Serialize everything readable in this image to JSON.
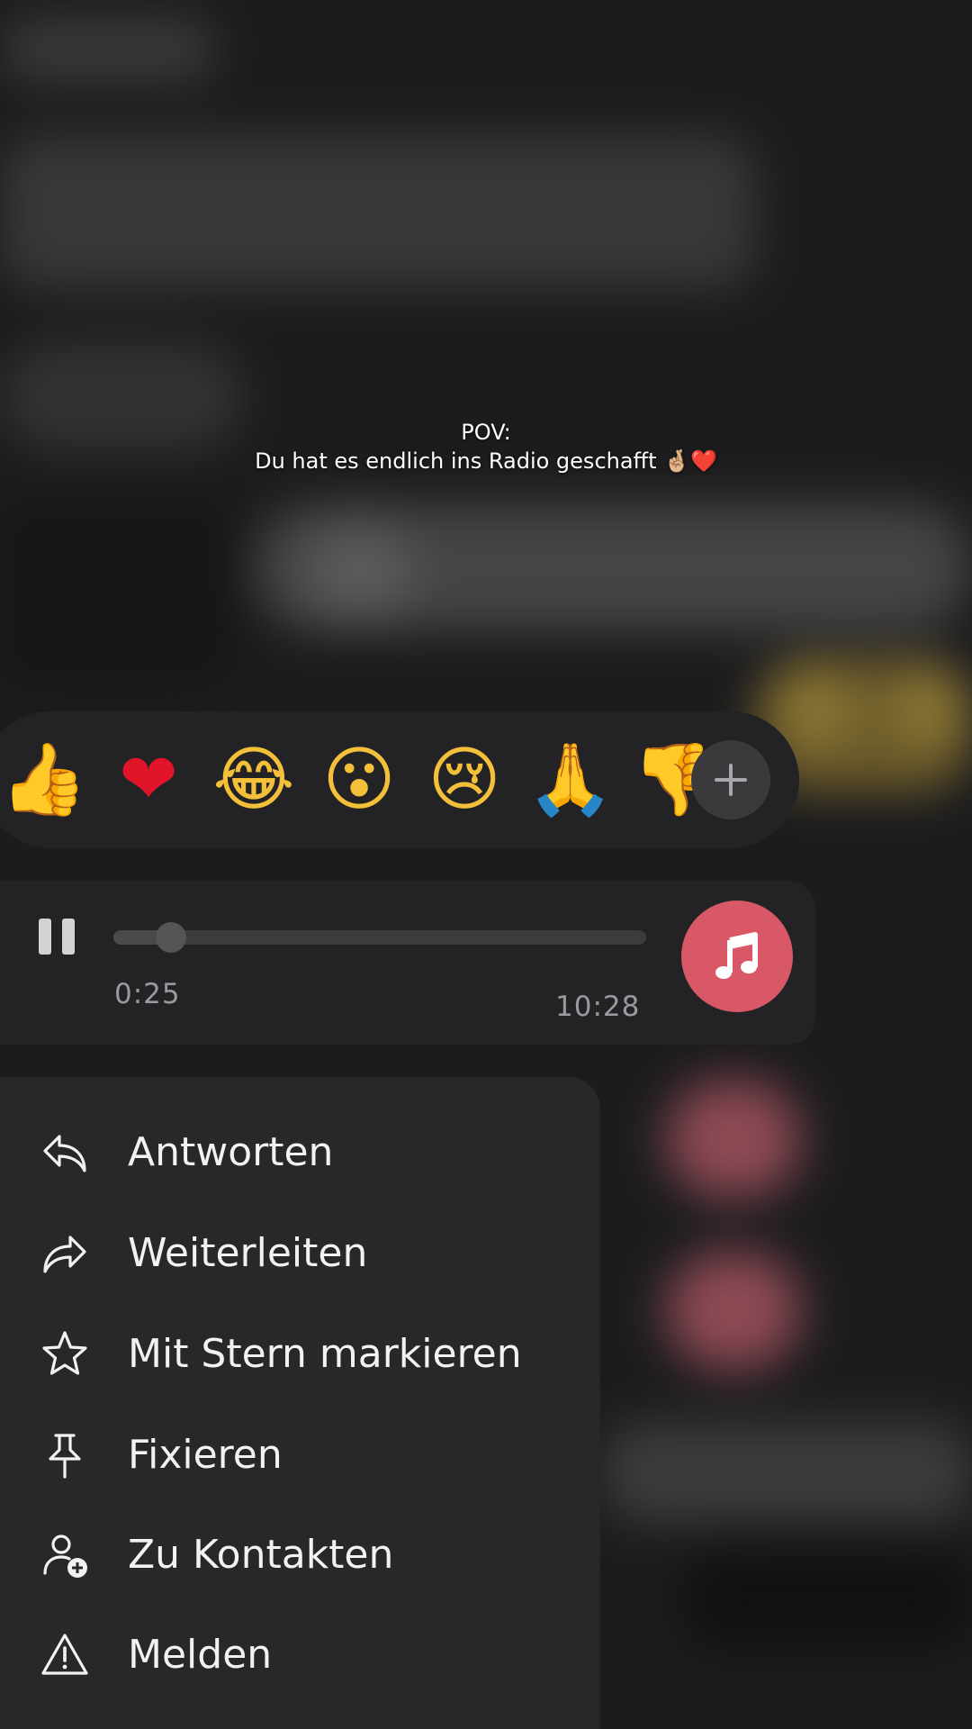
{
  "caption": {
    "line1": "POV:",
    "line2": "Du hat es endlich ins Radio geschafft 🤞🏼❤️"
  },
  "reactions": {
    "items": [
      {
        "emoji": "👍",
        "icon": "thumbs-up"
      },
      {
        "emoji": "❤",
        "icon": "red-heart"
      },
      {
        "emoji": "😂",
        "icon": "tears-of-joy"
      },
      {
        "emoji": "😮",
        "icon": "face-open-mouth"
      },
      {
        "emoji": "😢",
        "icon": "crying-face"
      },
      {
        "emoji": "🙏",
        "icon": "folded-hands"
      },
      {
        "emoji": "👎",
        "icon": "thumbs-down"
      }
    ],
    "add_icon": "plus-icon"
  },
  "audio": {
    "current_time": "0:25",
    "total_time": "10:28",
    "progress": 0.04,
    "state_icon": "pause-icon",
    "badge_icon": "music-note-icon",
    "badge_color": "#d95868"
  },
  "menu": {
    "items": [
      {
        "label": "Antworten",
        "icon": "reply-icon"
      },
      {
        "label": "Weiterleiten",
        "icon": "forward-icon"
      },
      {
        "label": "Mit Stern markieren",
        "icon": "star-icon"
      },
      {
        "label": "Fixieren",
        "icon": "pin-icon"
      },
      {
        "label": "Zu Kontakten",
        "icon": "add-contact-icon"
      },
      {
        "label": "Melden",
        "icon": "warning-icon"
      }
    ]
  }
}
